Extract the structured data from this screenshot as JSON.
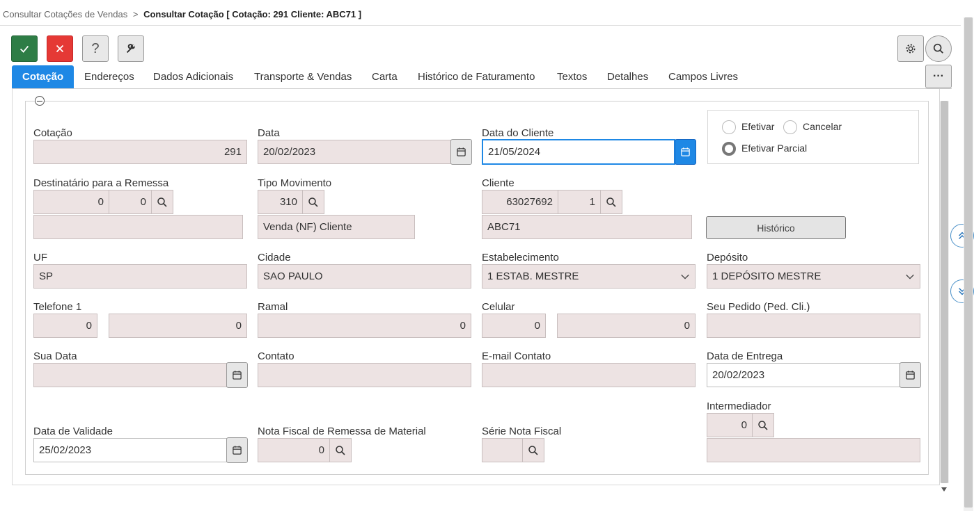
{
  "breadcrumb": {
    "parent": "Consultar Cotações de Vendas",
    "separator": ">",
    "current": "Consultar Cotação [ Cotação: 291 Cliente: ABC71 ]"
  },
  "toolbar": {
    "confirm_icon": "check-icon",
    "cancel_icon": "close-icon",
    "help_label": "?",
    "tools_icon": "wrench-icon",
    "settings_icon": "gear-icon",
    "search_icon": "search-icon",
    "more_label": "···"
  },
  "tabs": [
    {
      "label": "Cotação"
    },
    {
      "label": "Endereços"
    },
    {
      "label": "Dados Adicionais"
    },
    {
      "label": "Transporte & Vendas"
    },
    {
      "label": "Carta"
    },
    {
      "label": "Histórico de Faturamento"
    },
    {
      "label": "Textos"
    },
    {
      "label": "Detalhes"
    },
    {
      "label": "Campos Livres"
    }
  ],
  "form": {
    "cotacao": {
      "label": "Cotação",
      "value": "291"
    },
    "data": {
      "label": "Data",
      "value": "20/02/2023"
    },
    "data_cliente": {
      "label": "Data do Cliente",
      "value": "21/05/2024"
    },
    "radios": {
      "efetivar": "Efetivar",
      "cancelar": "Cancelar",
      "efetivar_parcial": "Efetivar Parcial",
      "selected": "efetivar_parcial"
    },
    "destinatario": {
      "label": "Destinatário para a Remessa",
      "value1": "0",
      "value2": "0",
      "name": ""
    },
    "tipo_movimento": {
      "label": "Tipo Movimento",
      "code": "310",
      "desc": "Venda (NF) Cliente"
    },
    "cliente": {
      "label": "Cliente",
      "code": "63027692",
      "seq": "1",
      "name": "ABC71"
    },
    "historico_button": "Histórico",
    "uf": {
      "label": "UF",
      "value": "SP"
    },
    "cidade": {
      "label": "Cidade",
      "value": "SAO PAULO"
    },
    "estabelecimento": {
      "label": "Estabelecimento",
      "value": "1 ESTAB. MESTRE"
    },
    "deposito": {
      "label": "Depósito",
      "value": "1 DEPÓSITO MESTRE"
    },
    "telefone": {
      "label": "Telefone 1",
      "ddd": "0",
      "number": "0"
    },
    "ramal": {
      "label": "Ramal",
      "value": "0"
    },
    "celular": {
      "label": "Celular",
      "ddd": "0",
      "number": "0"
    },
    "seu_pedido": {
      "label": "Seu Pedido (Ped. Cli.)",
      "value": ""
    },
    "sua_data": {
      "label": "Sua Data",
      "value": ""
    },
    "contato": {
      "label": "Contato",
      "value": ""
    },
    "email_contato": {
      "label": "E-mail Contato",
      "value": ""
    },
    "data_entrega": {
      "label": "Data de Entrega",
      "value": "20/02/2023"
    },
    "intermediador": {
      "label": "Intermediador",
      "value": "0",
      "name": ""
    },
    "data_validade": {
      "label": "Data de Validade",
      "value": "25/02/2023"
    },
    "nf_remessa": {
      "label": "Nota Fiscal de Remessa de Material",
      "value": "0"
    },
    "serie_nf": {
      "label": "Série Nota Fiscal",
      "value": ""
    }
  },
  "side": {
    "scroll_up_icon": "double-chevron-up-icon",
    "scroll_down_icon": "double-chevron-down-icon"
  }
}
